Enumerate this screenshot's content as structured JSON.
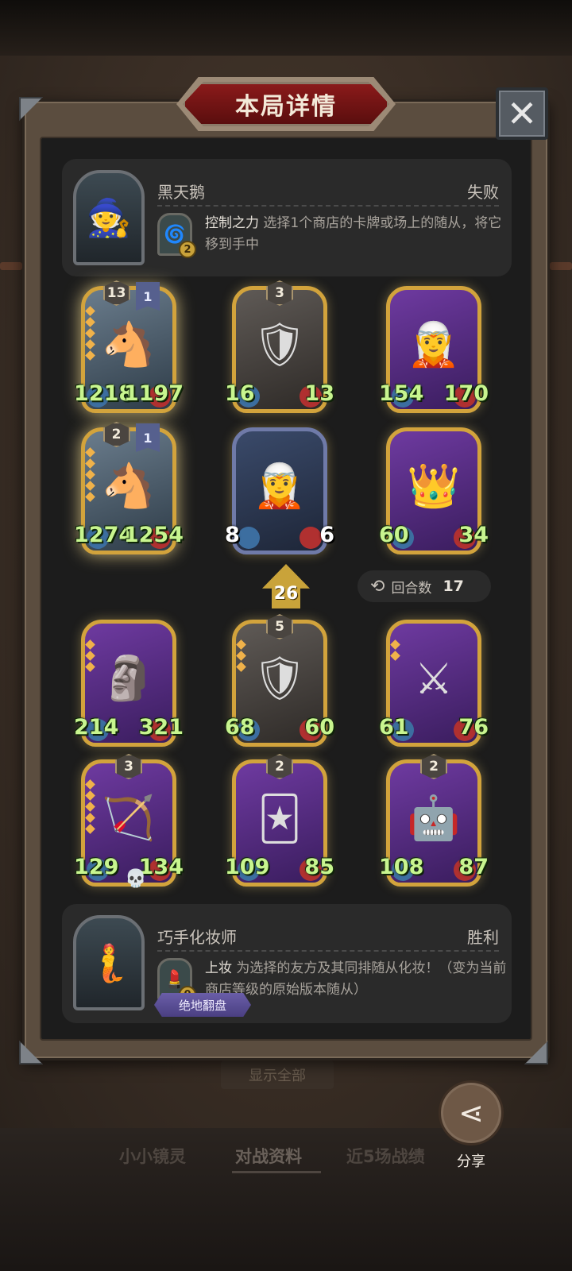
{
  "header": {
    "title": "本局详情",
    "close_glyph": "✕"
  },
  "top_player": {
    "name": "黑天鹅",
    "result": "失败",
    "hero_power": {
      "name": "控制之力",
      "cost": "2",
      "desc": "选择1个商店的卡牌或场上的随从，将它移到手中"
    }
  },
  "top_board": [
    {
      "tier": "13",
      "extra": "1",
      "atk": "1218",
      "hp": "1197",
      "stars": 5,
      "icon": "horse-icon",
      "glyph": "🐴"
    },
    {
      "tier": "3",
      "atk": "16",
      "hp": "13",
      "stars": 0,
      "icon": "shield-knight-icon",
      "glyph": "🛡"
    },
    {
      "atk": "154",
      "hp": "170",
      "stars": 0,
      "icon": "elf-mage-icon",
      "glyph": "🧝"
    },
    {
      "tier": "2",
      "extra": "1",
      "atk": "1274",
      "hp": "1254",
      "stars": 5,
      "icon": "horse-icon",
      "glyph": "🐴"
    },
    {
      "atk": "8",
      "hp": "6",
      "stars": 0,
      "icon": "elf-warrior-icon",
      "glyph": "🧝"
    },
    {
      "atk": "60",
      "hp": "34",
      "stars": 0,
      "icon": "dwarf-king-icon",
      "glyph": "👑"
    }
  ],
  "middle": {
    "level": "26",
    "rounds_label": "回合数",
    "rounds_value": "17"
  },
  "bottom_board": [
    {
      "atk": "214",
      "hp": "321",
      "stars": 3,
      "icon": "golem-icon",
      "glyph": "🗿"
    },
    {
      "tier": "5",
      "atk": "68",
      "hp": "60",
      "stars": 3,
      "icon": "shield-knight-icon",
      "glyph": "🛡"
    },
    {
      "atk": "61",
      "hp": "76",
      "stars": 2,
      "icon": "dark-knight-icon",
      "glyph": "⚔"
    },
    {
      "tier": "3",
      "atk": "129",
      "hp": "134",
      "stars": 5,
      "icon": "archer-icon",
      "glyph": "🏹"
    },
    {
      "tier": "2",
      "atk": "109",
      "hp": "85",
      "stars": 0,
      "icon": "card-knight-icon",
      "glyph": "🃏"
    },
    {
      "tier": "2",
      "atk": "108",
      "hp": "87",
      "stars": 0,
      "icon": "robot-icon",
      "glyph": "🤖"
    }
  ],
  "bottom_player": {
    "name": "巧手化妆师",
    "result": "胜利",
    "hero_power": {
      "name": "上妆",
      "cost": "0",
      "desc": "为选择的友方及其同排随从化妆！（变为当前商店等级的原始版本随从）"
    },
    "badge": "绝地翻盘"
  },
  "behind_button": "显示全部",
  "tabs": [
    {
      "label": "小小镜灵"
    },
    {
      "label": "对战资料"
    },
    {
      "label": "近5场战绩"
    }
  ],
  "share": {
    "label": "分享"
  },
  "colors": {
    "stat_green": "#c8f58f",
    "gold_frame": "#d2a33c",
    "title_red": "#8a1a1a"
  }
}
